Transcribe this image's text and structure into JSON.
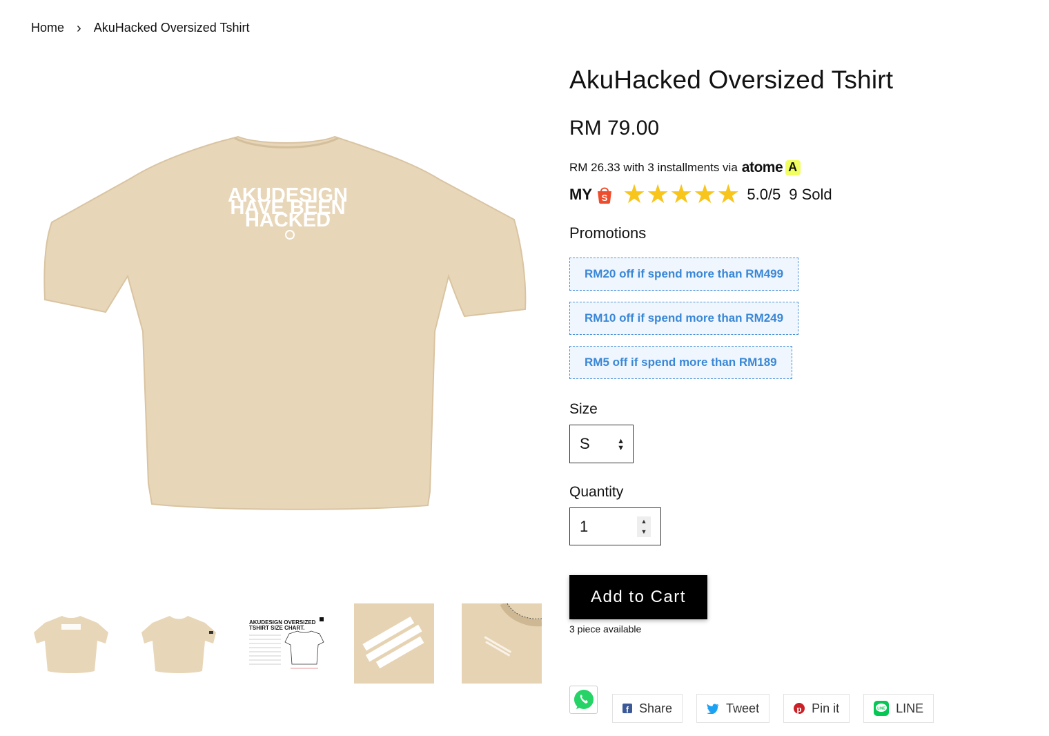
{
  "breadcrumb": {
    "home": "Home",
    "separator": "›",
    "current": "AkuHacked Oversized Tshirt"
  },
  "product": {
    "title": "AkuHacked Oversized Tshirt",
    "price": "RM 79.00",
    "installment_text": "RM 26.33 with 3 installments via",
    "installment_brand": "atome",
    "region_label": "MY",
    "rating_stars": 5,
    "rating_text": "5.0/5",
    "sold_text": "9 Sold",
    "print_text": [
      "AKUDESIGN",
      "HAVE BEEN",
      "HACKED"
    ]
  },
  "promotions": {
    "title": "Promotions",
    "items": [
      "RM20 off if spend more than RM499",
      "RM10 off if spend more than RM249",
      "RM5 off if spend more than RM189"
    ]
  },
  "size": {
    "label": "Size",
    "selected": "S"
  },
  "quantity": {
    "label": "Quantity",
    "value": "1"
  },
  "cart": {
    "button_label": "Add to Cart",
    "stock_text": "3 piece available"
  },
  "share": {
    "facebook": "Share",
    "twitter": "Tweet",
    "pinterest": "Pin it",
    "line": "LINE",
    "line_icon_text": "LINE"
  },
  "thumbnail_text": {
    "size_chart_title": "AKUDESIGN OVERSIZED",
    "size_chart_subtitle": "TSHIRT SIZE CHART."
  },
  "colors": {
    "shirt": "#e8d6b8",
    "promo_text": "#3a87d6",
    "star": "#f8c51c",
    "shopee": "#ee4d2d",
    "whatsapp": "#25d366",
    "line": "#06c755"
  }
}
